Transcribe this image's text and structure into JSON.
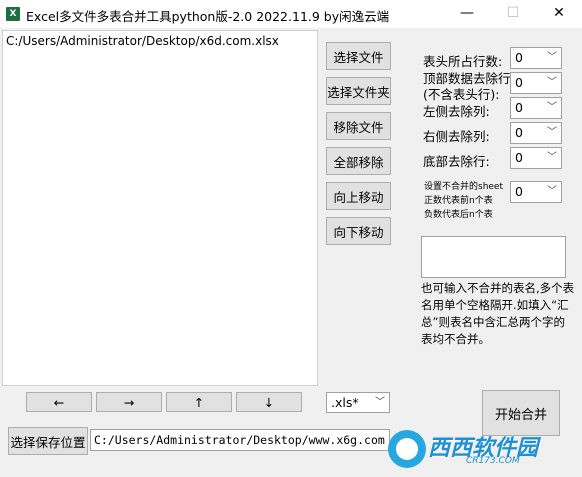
{
  "window": {
    "title": "Excel多文件多表合并工具python版-2.0 2022.11.9 by闲逸云端",
    "app_icon": "X",
    "minimize": "—",
    "maximize": "☐",
    "close": "✕"
  },
  "file_list": {
    "items": [
      "C:/Users/Administrator/Desktop/x6d.com.xlsx"
    ]
  },
  "buttons": {
    "select_file": "选择文件",
    "select_folder": "选择文件夹",
    "remove_file": "移除文件",
    "remove_all": "全部移除",
    "move_up": "向上移动",
    "move_down": "向下移动",
    "arrow_left": "←",
    "arrow_right": "→",
    "arrow_up": "↑",
    "arrow_down": "↓",
    "select_save_location": "选择保存位置",
    "start_merge": "开始合并"
  },
  "settings": {
    "header_rows_label": "表头所占行数:",
    "header_rows_value": "0",
    "top_remove_label_1": "顶部数据去除行",
    "top_remove_label_2": "(不含表头行):",
    "top_remove_value": "0",
    "left_cols_label": "左侧去除列:",
    "left_cols_value": "0",
    "right_cols_label": "右侧去除列:",
    "right_cols_value": "0",
    "bottom_rows_label": "底部去除行:",
    "bottom_rows_value": "0",
    "sheet_skip_label_1": "设置不合并的sheet",
    "sheet_skip_label_2": "正数代表前n个表",
    "sheet_skip_label_3": "负数代表后n个表",
    "sheet_skip_value": "0"
  },
  "hint": {
    "text": "也可输入不合并的表名,多个表名用单个空格隔开.如填入“汇总”则表名中含汇总两个字的表均不合并。"
  },
  "output": {
    "extension": ".xls*",
    "save_path": "C:/Users/Administrator/Desktop/www.x6g.com"
  },
  "watermark": {
    "text": "西西软件园",
    "url": "CR173.COM"
  }
}
